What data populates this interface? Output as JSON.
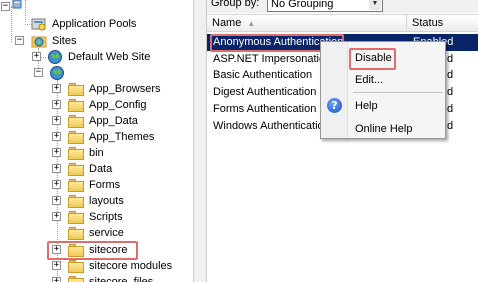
{
  "tree": {
    "items": [
      {
        "label": "Application Pools"
      },
      {
        "label": "Sites"
      },
      {
        "label": "Default Web Site"
      },
      {
        "label": "App_Browsers"
      },
      {
        "label": "App_Config"
      },
      {
        "label": "App_Data"
      },
      {
        "label": "App_Themes"
      },
      {
        "label": "bin"
      },
      {
        "label": "Data"
      },
      {
        "label": "Forms"
      },
      {
        "label": "layouts"
      },
      {
        "label": "Scripts"
      },
      {
        "label": "service"
      },
      {
        "label": "sitecore"
      },
      {
        "label": "sitecore modules"
      },
      {
        "label": "sitecore_files"
      }
    ],
    "expander_plus": "+",
    "expander_minus": "−"
  },
  "toolbar": {
    "groupby_label": "Group by:",
    "groupby_value": "No Grouping",
    "groupby_arrow": "▼"
  },
  "list": {
    "columns": {
      "name": "Name",
      "status": "Status",
      "sort_indicator": "▲"
    },
    "rows": [
      {
        "name": "Anonymous Authentication",
        "status": "Enabled"
      },
      {
        "name": "ASP.NET Impersonation",
        "status": "d"
      },
      {
        "name": "Basic Authentication",
        "status": "d"
      },
      {
        "name": "Digest Authentication",
        "status": "d"
      },
      {
        "name": "Forms Authentication",
        "status": "d"
      },
      {
        "name": "Windows Authentication",
        "status": "d"
      }
    ]
  },
  "context_menu": {
    "items": [
      {
        "label": "Disable"
      },
      {
        "label": "Edit..."
      },
      {
        "label": "Help"
      },
      {
        "label": "Online Help"
      }
    ],
    "help_icon_glyph": "?"
  },
  "colors": {
    "selection": "#0a246a",
    "highlight_box": "#e06d6d",
    "folder": "#f2c955"
  }
}
